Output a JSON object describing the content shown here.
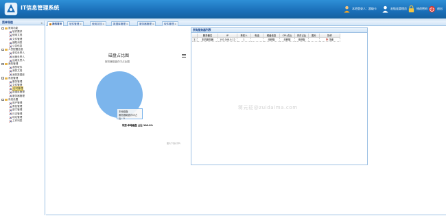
{
  "app_title": "IT信息管理系统",
  "header": {
    "user_label": "本地登录人：超级卡",
    "admin_label": "宏链连管理员",
    "change_password": "修改密码",
    "logout": "退出"
  },
  "sidebar": {
    "title": "菜单导航",
    "collapse": "«",
    "groups": [
      {
        "label": "常用功能",
        "items": [
          "软件需求",
          "使用文档",
          "文件管理",
          "通知消息",
          "公告信息"
        ]
      },
      {
        "label": "人员配置信息",
        "items": [
          "单位负责人",
          "运营负责人",
          "运维负责人"
        ]
      },
      {
        "label": "我的管理",
        "items": [
          "我的软件",
          "我的文档",
          "我的数据库"
        ]
      },
      {
        "label": "系统管理",
        "items": [
          "服务管理",
          "文件管理",
          "定时管理",
          "数据库管理",
          "服务器管理"
        ]
      },
      {
        "label": "系统设置",
        "items": [
          "用户管理",
          "角色管理",
          "部门管理",
          "日志管理",
          "地址管理",
          "工作列表"
        ]
      }
    ],
    "selected_item": "定时管理"
  },
  "tabs": [
    {
      "label": "我的首页",
      "closable": false,
      "active": true
    },
    {
      "label": "软件管理",
      "closable": true
    },
    {
      "label": "使用文档",
      "closable": true
    },
    {
      "label": "数据库管理",
      "closable": true
    },
    {
      "label": "服务器管理",
      "closable": true
    },
    {
      "label": "软件管理",
      "closable": true
    }
  ],
  "chart_data": {
    "type": "pie",
    "title": "磁盘占比图",
    "subtitle": "服务器磁盘存中占比图",
    "slices": [
      {
        "name": "状态:本地磁盘",
        "value": 100.0,
        "color": "#7cb5ec"
      }
    ],
    "tooltip_name": "本地磁盘",
    "tooltip_line": "服务器磁盘存中占比：0",
    "data_label": "状态:本地磁盘 占比 100.0%",
    "credit": "图片下载(打印)"
  },
  "table": {
    "title": "所有服务器列表",
    "columns": [
      "",
      "服务器名",
      "IP",
      "责任人",
      "电话",
      "磁盘信息",
      "CPU占比",
      "内存占比",
      "图片",
      "操作"
    ],
    "rows": [
      [
        "1",
        "本机服务器",
        "192.168.0.12",
        "1",
        "",
        "未获取",
        "未获取",
        "未获取",
        "",
        "详细"
      ]
    ]
  },
  "watermark": "蒋元征@zuidaima.com",
  "colors": {
    "header_top": "#2e8fd6",
    "header_bottom": "#15609f",
    "accent_border": "#9cc0e3",
    "pie_fill": "#7cb5ec",
    "selected_bg": "#fbec88"
  }
}
